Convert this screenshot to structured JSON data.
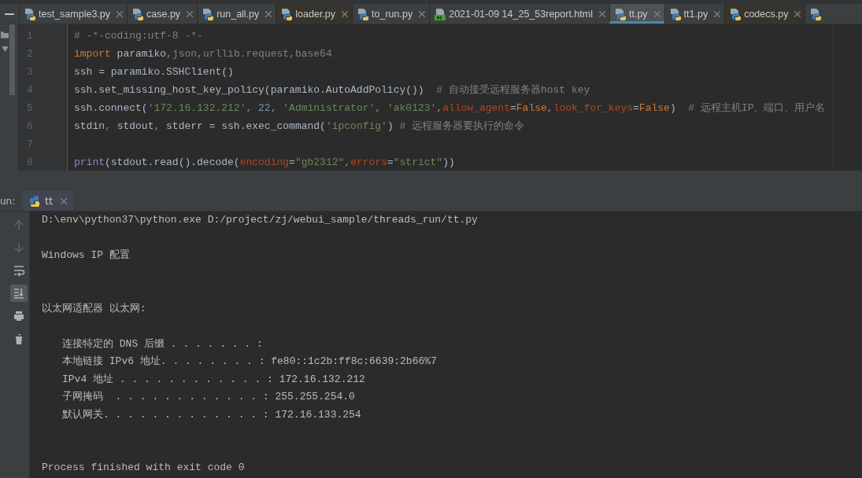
{
  "tabs": [
    {
      "kind": "python",
      "label": "test_sample3.py",
      "selected": false,
      "tinted": false
    },
    {
      "kind": "python",
      "label": "case.py",
      "selected": false,
      "tinted": false
    },
    {
      "kind": "python",
      "label": "run_all.py",
      "selected": false,
      "tinted": false
    },
    {
      "kind": "python",
      "label": "loader.py",
      "selected": false,
      "tinted": true
    },
    {
      "kind": "python",
      "label": "to_run.py",
      "selected": false,
      "tinted": false
    },
    {
      "kind": "html",
      "label": "2021-01-09 14_25_53report.html",
      "selected": false,
      "tinted": false
    },
    {
      "kind": "python",
      "label": "tt.py",
      "selected": true,
      "tinted": false
    },
    {
      "kind": "python",
      "label": "tt1.py",
      "selected": false,
      "tinted": false
    },
    {
      "kind": "python",
      "label": "codecs.py",
      "selected": false,
      "tinted": true
    },
    {
      "kind": "python",
      "selected": false,
      "tinted": false
    }
  ],
  "editor": {
    "lines": [
      {
        "number": "1",
        "tokens": [
          {
            "kind": "comment",
            "text": "# -*-coding:utf-8 -*-"
          }
        ]
      },
      {
        "number": "2",
        "tokens": [
          {
            "kind": "keyword",
            "text": "import"
          },
          {
            "kind": "plain",
            "text": " paramiko"
          },
          {
            "kind": "keyword",
            "text": ","
          },
          {
            "kind": "unused",
            "text": "json"
          },
          {
            "kind": "keyword",
            "text": ","
          },
          {
            "kind": "unused",
            "text": "urllib.request"
          },
          {
            "kind": "keyword",
            "text": ","
          },
          {
            "kind": "unused",
            "text": "base64"
          }
        ]
      },
      {
        "number": "3",
        "tokens": [
          {
            "kind": "plain",
            "text": "ssh = paramiko.SSHClient()"
          }
        ]
      },
      {
        "number": "4",
        "tokens": [
          {
            "kind": "plain",
            "text": "ssh.set_missing_host_key_policy(paramiko.AutoAddPolicy())"
          },
          {
            "kind": "comment",
            "text": "  # 自动接受远程服务器host key"
          }
        ]
      },
      {
        "number": "5",
        "tokens": [
          {
            "kind": "plain",
            "text": "ssh.connect("
          },
          {
            "kind": "string",
            "text": "'172.16.132.212'"
          },
          {
            "kind": "keyword",
            "text": ", "
          },
          {
            "kind": "number",
            "text": "22"
          },
          {
            "kind": "keyword",
            "text": ", "
          },
          {
            "kind": "string",
            "text": "'Administrator'"
          },
          {
            "kind": "keyword",
            "text": ", "
          },
          {
            "kind": "string",
            "text": "'ak0123'"
          },
          {
            "kind": "keyword",
            "text": ","
          },
          {
            "kind": "param",
            "text": "allow_agent"
          },
          {
            "kind": "plain",
            "text": "="
          },
          {
            "kind": "keyword",
            "text": "False"
          },
          {
            "kind": "keyword",
            "text": ","
          },
          {
            "kind": "param",
            "text": "look_for_keys"
          },
          {
            "kind": "plain",
            "text": "="
          },
          {
            "kind": "keyword",
            "text": "False"
          },
          {
            "kind": "plain",
            "text": ")"
          },
          {
            "kind": "comment",
            "text": "  # 远程主机IP、端口、用户名"
          }
        ]
      },
      {
        "number": "6",
        "tokens": [
          {
            "kind": "plain",
            "text": "stdin"
          },
          {
            "kind": "keyword",
            "text": ","
          },
          {
            "kind": "plain",
            "text": " stdout"
          },
          {
            "kind": "keyword",
            "text": ","
          },
          {
            "kind": "plain",
            "text": " stderr = ssh.exec_command("
          },
          {
            "kind": "string",
            "text": "'ipconfig'"
          },
          {
            "kind": "plain",
            "text": ")"
          },
          {
            "kind": "comment",
            "text": " # 远程服务器要执行的命令"
          }
        ]
      },
      {
        "number": "7"
      },
      {
        "number": "8",
        "tokens": [
          {
            "kind": "builtin",
            "text": "print"
          },
          {
            "kind": "plain",
            "text": "(stdout.read().decode("
          },
          {
            "kind": "param",
            "text": "encoding"
          },
          {
            "kind": "plain",
            "text": "="
          },
          {
            "kind": "string",
            "text": "\"gb2312\""
          },
          {
            "kind": "keyword",
            "text": ","
          },
          {
            "kind": "param",
            "text": "errors"
          },
          {
            "kind": "plain",
            "text": "="
          },
          {
            "kind": "string",
            "text": "\"strict\""
          },
          {
            "kind": "plain",
            "text": "))"
          }
        ]
      }
    ]
  },
  "run_panel": {
    "label": "un:",
    "tab": {
      "label": "tt",
      "selected": true
    },
    "tools": [
      {
        "kind": "up",
        "disabled": true,
        "selected": false
      },
      {
        "kind": "down",
        "disabled": true,
        "selected": false
      },
      {
        "kind": "wrap",
        "disabled": false,
        "selected": false
      },
      {
        "kind": "scroll_end",
        "disabled": false,
        "selected": true
      },
      {
        "kind": "print",
        "disabled": false,
        "selected": false
      },
      {
        "kind": "trash",
        "disabled": false,
        "selected": false
      }
    ],
    "console": [
      {
        "kind": "command",
        "text": "D:\\env\\python37\\python.exe D:/project/zj/webui_sample/threads_run/tt.py"
      },
      {
        "kind": "title",
        "text": "Windows IP 配置"
      },
      {
        "kind": "section",
        "text": "以太网适配器 以太网:"
      },
      {
        "kind": "entry",
        "text": "连接特定的 DNS 后缀 . . . . . . . :"
      },
      {
        "kind": "entry",
        "text": "本地链接 IPv6 地址. . . . . . . . : fe80::1c2b:ff8c:6639:2b66%7"
      },
      {
        "kind": "entry",
        "text": "IPv4 地址 . . . . . . . . . . . . : 172.16.132.212"
      },
      {
        "kind": "entry",
        "text": "子网掩码  . . . . . . . . . . . . : 255.255.254.0"
      },
      {
        "kind": "entry",
        "text": "默认网关. . . . . . . . . . . . . : 172.16.133.254"
      },
      {
        "kind": "exit",
        "text": "Process finished with exit code 0"
      }
    ]
  }
}
